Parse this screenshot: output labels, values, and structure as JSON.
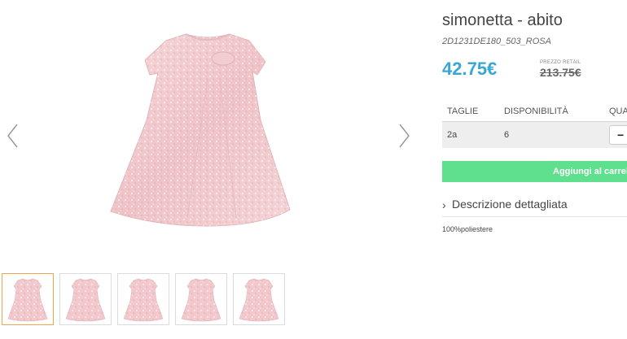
{
  "gallery": {
    "main_image": "pink-metallic-dress",
    "prev_icon": "chevron-left-icon",
    "next_icon": "chevron-right-icon",
    "thumbnails": [
      "pink-metallic-dress",
      "pink-metallic-dress",
      "pink-metallic-dress",
      "pink-metallic-dress",
      "pink-metallic-dress"
    ],
    "active_thumbnail": 0
  },
  "product": {
    "title": "simonetta - abito",
    "sku": "2D1231DE180_503_ROSA",
    "price": "42.75€",
    "retail_label": "PREZZO RETAIL",
    "retail_price": "213.75€"
  },
  "sizes_table": {
    "headers": [
      "TAGLIE",
      "DISPONIBILITÀ",
      "QUA"
    ],
    "rows": [
      {
        "size": "2a",
        "availability": "6",
        "qty_button": "−"
      }
    ]
  },
  "cart": {
    "label": "Aggiungi al carrello"
  },
  "description": {
    "toggle_icon": "chevron-right-icon",
    "toggle_label": "Descrizione dettagliata",
    "material": "100%poliestere"
  },
  "colors": {
    "price": "#3aa6d8",
    "cart_button": "#5ee08e",
    "active_thumb_border": "#f0a64a",
    "dress": "#f2c8cc"
  }
}
